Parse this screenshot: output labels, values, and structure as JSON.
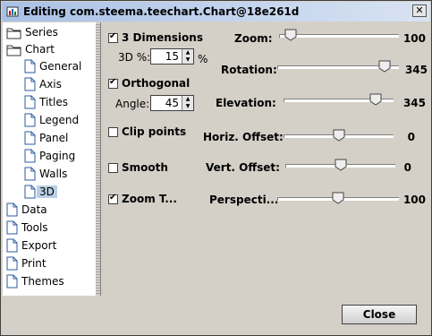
{
  "window": {
    "title": "Editing com.steema.teechart.Chart@18e261d",
    "close_glyph": "✕"
  },
  "tree": {
    "items": [
      {
        "label": "Series"
      },
      {
        "label": "Chart"
      },
      {
        "label": "General"
      },
      {
        "label": "Axis"
      },
      {
        "label": "Titles"
      },
      {
        "label": "Legend"
      },
      {
        "label": "Panel"
      },
      {
        "label": "Paging"
      },
      {
        "label": "Walls"
      },
      {
        "label": "3D"
      },
      {
        "label": "Data"
      },
      {
        "label": "Tools"
      },
      {
        "label": "Export"
      },
      {
        "label": "Print"
      },
      {
        "label": "Themes"
      }
    ],
    "selected": "3D"
  },
  "options": {
    "three_d": {
      "label": "3 Dimensions",
      "checked": true
    },
    "three_d_percent": {
      "label": "3D %:",
      "value": "15",
      "unit": "%"
    },
    "orthogonal": {
      "label": "Orthogonal",
      "checked": true
    },
    "angle": {
      "label": "Angle:",
      "value": "45"
    },
    "clip_points": {
      "label": "Clip points",
      "checked": false
    },
    "smooth": {
      "label": "Smooth",
      "checked": false
    },
    "zoom_text": {
      "label": "Zoom T...",
      "checked": true
    }
  },
  "sliders": {
    "zoom": {
      "label": "Zoom:",
      "value": "100",
      "fraction": 0.1
    },
    "rotation": {
      "label": "Rotation:",
      "value": "345",
      "fraction": 0.88
    },
    "elevation": {
      "label": "Elevation:",
      "value": "345",
      "fraction": 0.84
    },
    "horiz_offset": {
      "label": "Horiz. Offset:",
      "value": "0",
      "fraction": 0.5
    },
    "vert_offset": {
      "label": "Vert. Offset:",
      "value": "0",
      "fraction": 0.5
    },
    "perspective": {
      "label": "Perspecti...",
      "value": "100",
      "fraction": 0.5
    }
  },
  "buttons": {
    "close": "Close"
  }
}
